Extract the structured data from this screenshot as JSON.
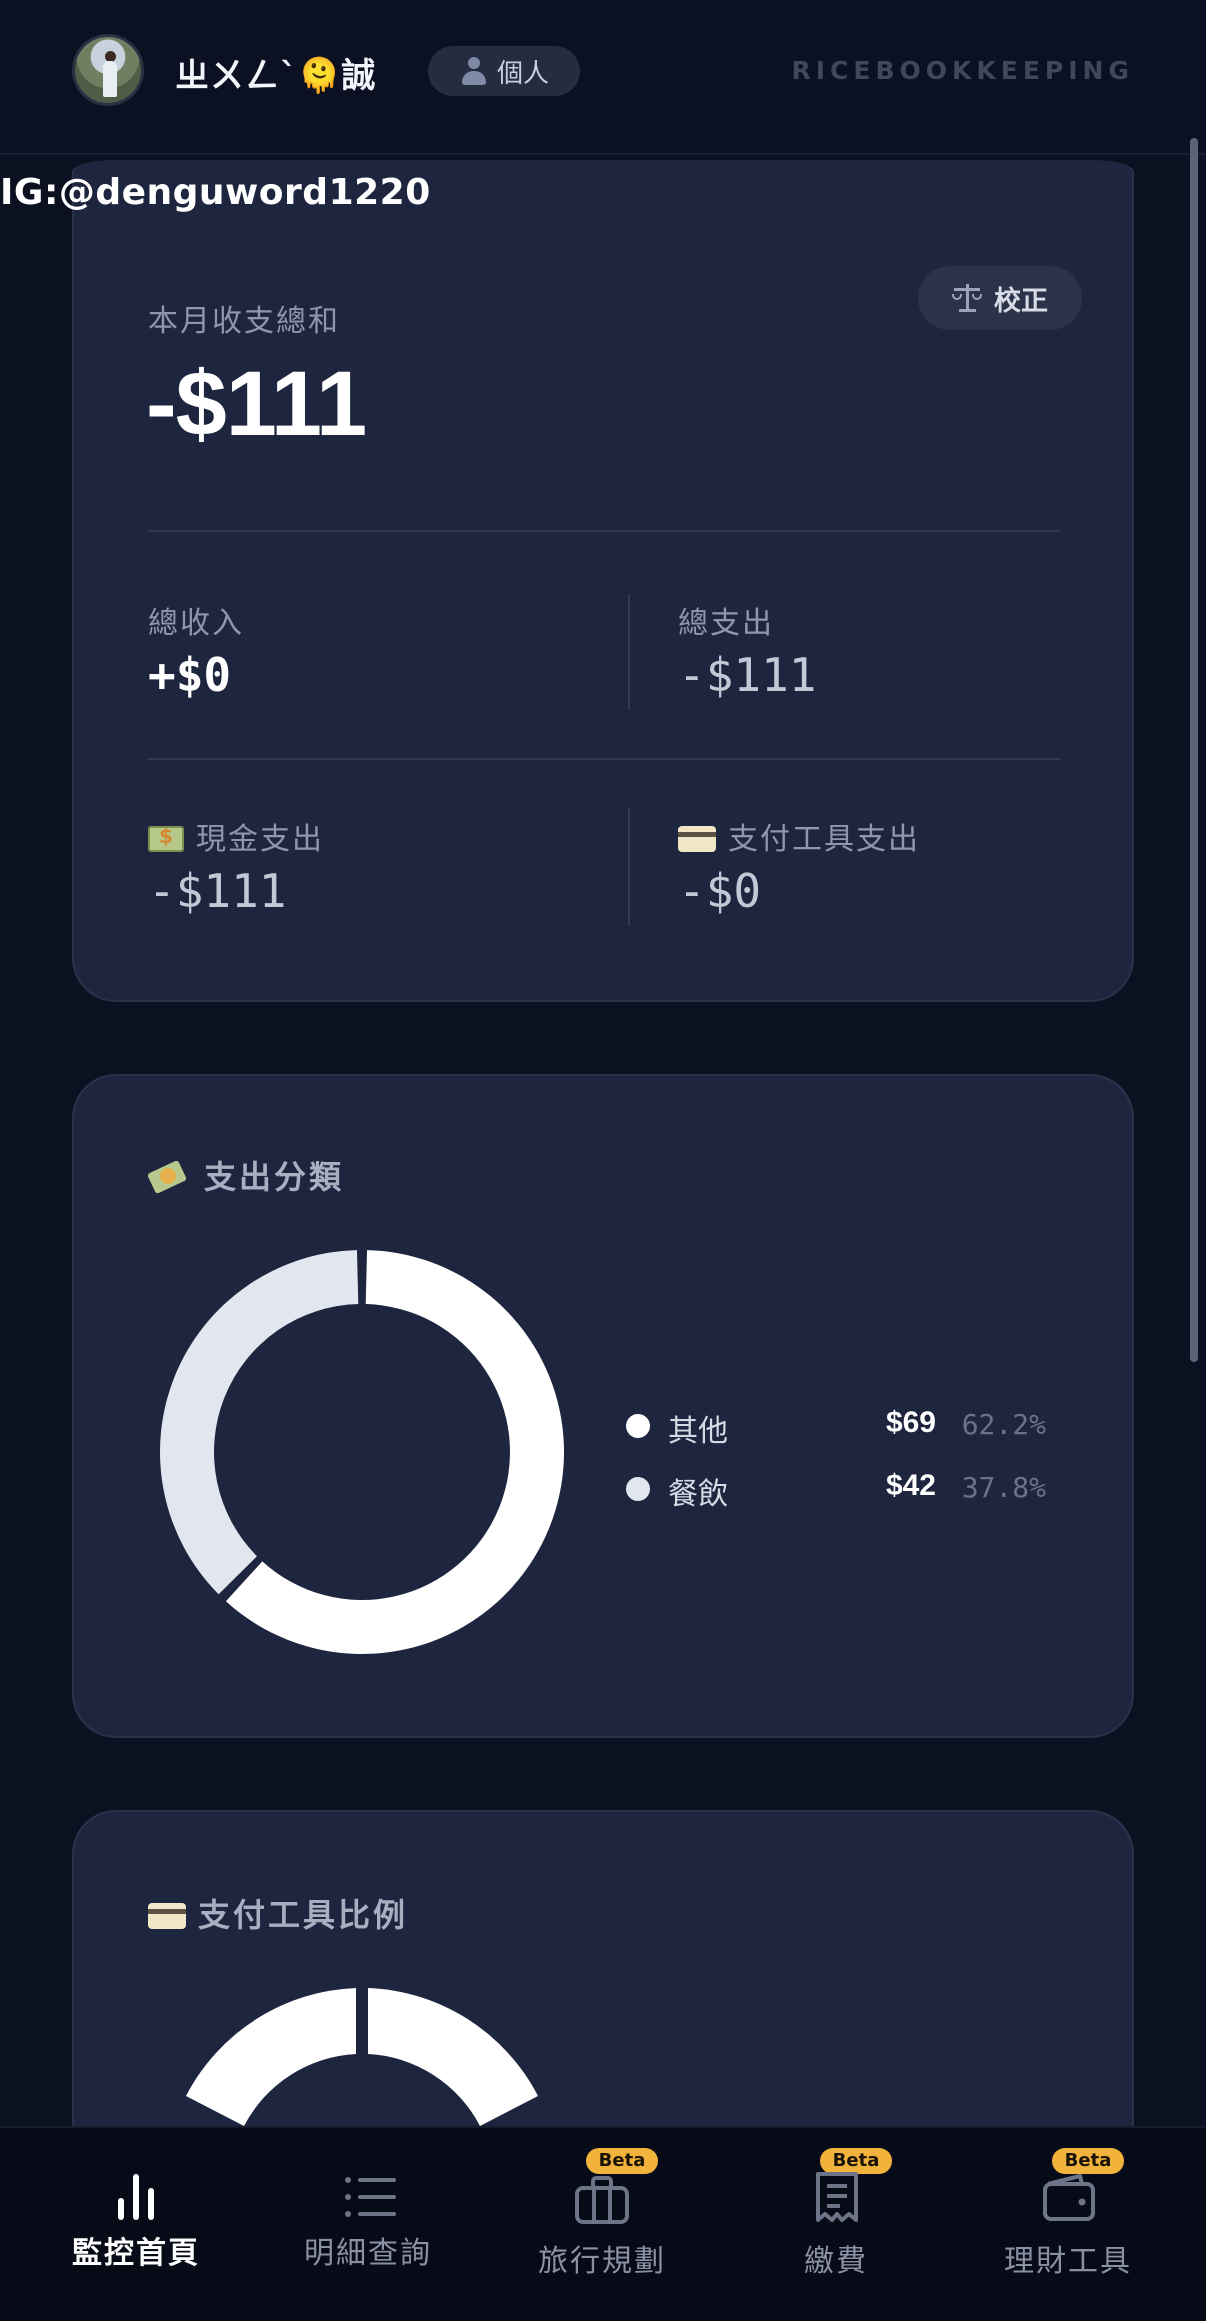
{
  "header": {
    "username": "ㄓㄨㄥˋ🫠誠",
    "mode_label": "個人",
    "brand": "RICEBOOKKEEPING"
  },
  "overlay": {
    "ig_handle": "IG:@denguword1220"
  },
  "summary": {
    "title": "本月收支總和",
    "total": "-$111",
    "calibrate_label": "校正",
    "income_label": "總收入",
    "income_value": "+$0",
    "expense_label": "總支出",
    "expense_value": "-$111",
    "cash_label": "現金支出",
    "cash_value": "-$111",
    "payment_label": "支付工具支出",
    "payment_value": "-$0"
  },
  "category_card": {
    "title": "支出分類",
    "legend": [
      {
        "name": "其他",
        "amount": "$69",
        "percent": "62.2%",
        "color": "#ffffff"
      },
      {
        "name": "餐飲",
        "amount": "$42",
        "percent": "37.8%",
        "color": "#e2e6ee"
      }
    ]
  },
  "payment_card": {
    "title": "支付工具比例"
  },
  "nav": {
    "items": [
      {
        "label": "監控首頁",
        "active": true
      },
      {
        "label": "明細查詢",
        "active": false
      },
      {
        "label": "旅行規劃",
        "beta": "Beta"
      },
      {
        "label": "繳費",
        "beta": "Beta"
      },
      {
        "label": "理財工具",
        "beta": "Beta"
      }
    ]
  },
  "chart_data": [
    {
      "type": "pie",
      "title": "支出分類",
      "categories": [
        "其他",
        "餐飲"
      ],
      "values": [
        69,
        42
      ],
      "percent": [
        62.2,
        37.8
      ],
      "colors": [
        "#ffffff",
        "#e2e6ee"
      ],
      "legend_position": "right"
    }
  ],
  "colors": {
    "background": "#0c1122",
    "card": "#1e253e",
    "beta_badge": "#f1b33b",
    "muted_text": "#8f97ab"
  }
}
